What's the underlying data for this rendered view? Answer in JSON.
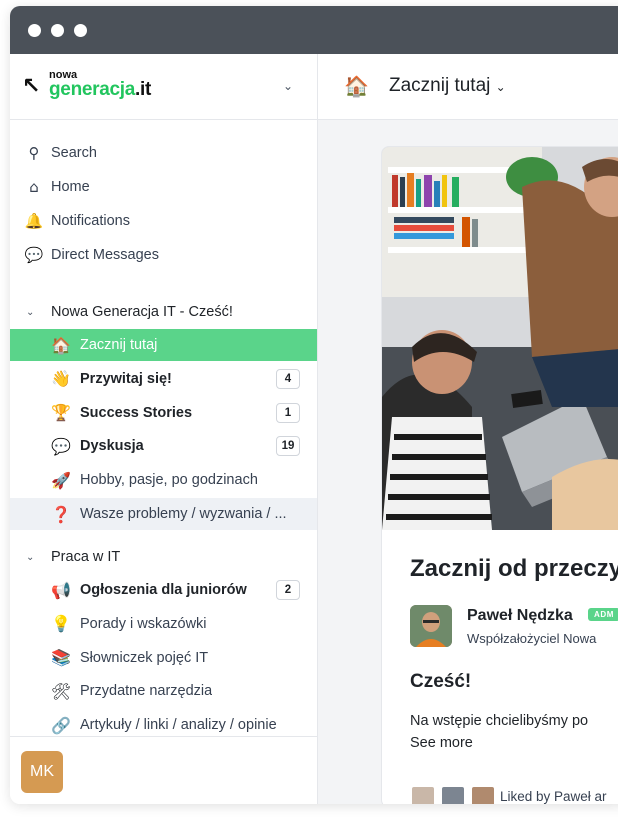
{
  "brand": {
    "small": "nowa",
    "main": "generacja",
    "tld": ".it"
  },
  "nav": [
    {
      "icon": "search-icon",
      "glyph": "⚲",
      "label": "Search"
    },
    {
      "icon": "home-icon",
      "glyph": "⌂",
      "label": "Home"
    },
    {
      "icon": "bell-icon",
      "glyph": "🔔",
      "label": "Notifications"
    },
    {
      "icon": "message-icon",
      "glyph": "💬",
      "label": "Direct Messages"
    }
  ],
  "groups": [
    {
      "label": "Nowa Generacja IT - Cześć!",
      "spaces": [
        {
          "emoji": "🏠",
          "label": "Zacznij tutaj",
          "active": true
        },
        {
          "emoji": "👋",
          "label": "Przywitaj się!",
          "bold": true,
          "badge": "4"
        },
        {
          "emoji": "🏆",
          "label": "Success Stories",
          "bold": true,
          "badge": "1"
        },
        {
          "emoji": "💬",
          "label": "Dyskusja",
          "bold": true,
          "badge": "19"
        },
        {
          "emoji": "🚀",
          "label": "Hobby, pasje, po godzinach"
        },
        {
          "emoji": "❓",
          "label": "Wasze problemy / wyzwania / ...",
          "hover": true
        }
      ]
    },
    {
      "label": "Praca w IT",
      "spaces": [
        {
          "emoji": "📢",
          "label": "Ogłoszenia dla juniorów",
          "bold": true,
          "badge": "2"
        },
        {
          "emoji": "💡",
          "label": "Porady i wskazówki"
        },
        {
          "emoji": "📚",
          "label": "Słowniczek pojęć IT"
        },
        {
          "emoji": "🛠",
          "label": "Przydatne narzędzia"
        },
        {
          "emoji": "🔗",
          "label": "Artykuły / linki / analizy / opinie"
        }
      ]
    }
  ],
  "user": {
    "initials": "MK"
  },
  "header": {
    "emoji": "🏠",
    "title": "Zacznij tutaj"
  },
  "post": {
    "title": "Zacznij od przeczy",
    "author": "Paweł Nędzka",
    "author_badge": "ADM",
    "author_role": "Współzałożyciel Nowa",
    "greeting": "Cześć!",
    "body": "Na wstępie chcielibyśmy po",
    "see_more": "See more",
    "liked_by": "Liked by Paweł ar"
  },
  "colors": {
    "accent": "#5ad48a",
    "brand_green": "#22c55e",
    "titlebar": "#4b5159",
    "avatar": "#d59a52"
  }
}
